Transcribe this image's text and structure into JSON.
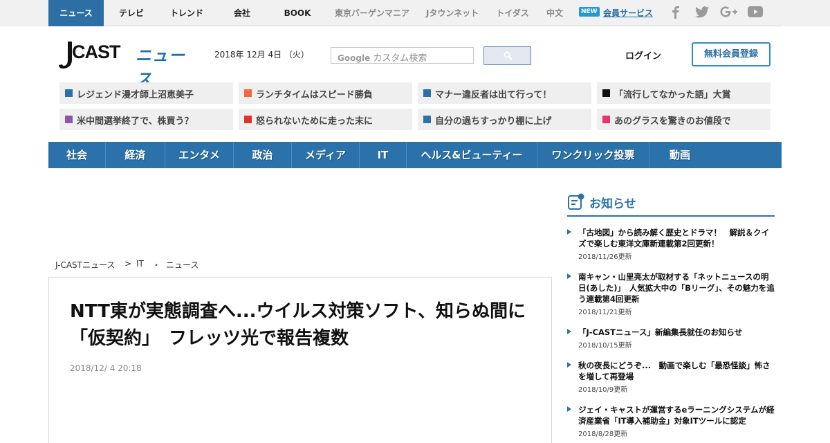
{
  "topnav": {
    "items": [
      {
        "label": "ニュース",
        "active": true
      },
      {
        "label": "テレビ"
      },
      {
        "label": "トレンド"
      },
      {
        "label": "会社"
      },
      {
        "label": "BOOK"
      },
      {
        "label": "東京バーゲンマニア"
      },
      {
        "label": "Jタウンネット"
      },
      {
        "label": "トイダス"
      },
      {
        "label": "中文"
      }
    ],
    "new_badge": "NEW",
    "member_link": "会員サービス",
    "social_icons": [
      "facebook-icon",
      "twitter-icon",
      "google-plus-icon",
      "youtube-icon"
    ]
  },
  "header": {
    "logo_text": "CAST",
    "logo_news": "ニュース",
    "date": "2018年 12月 4日 （火）",
    "search_placeholder": "カスタム検索",
    "search_brand": "Google",
    "login": "ログイン",
    "register": "無料会員登録"
  },
  "topics": [
    {
      "label": "レジェンド漫才師上沼恵美子",
      "color": "#2a72a9"
    },
    {
      "label": "ランチタイムはスピード勝負",
      "color": "#f26a3c"
    },
    {
      "label": "マナー違反者は出て行って！",
      "color": "#2a72a9"
    },
    {
      "label": "「流行してなかった語」大賞",
      "color": "#111111"
    },
    {
      "label": "米中間選挙終了で、株買う？",
      "color": "#8e56a8"
    },
    {
      "label": "怒られないために走った末に",
      "color": "#e0342a"
    },
    {
      "label": "自分の過ちすっかり棚に上げ",
      "color": "#2a72a9"
    },
    {
      "label": "あのグラスを驚きのお値段で",
      "color": "#e8336b"
    }
  ],
  "categories": [
    "社会",
    "経済",
    "エンタメ",
    "政治",
    "メディア",
    "IT",
    "ヘルス&ビューティー",
    "ワンクリック投票",
    "動画"
  ],
  "breadcrumb": {
    "home": "J-CASTニュース",
    "sep1": ">",
    "section": "IT",
    "sep2": "・",
    "sub": "ニュース"
  },
  "article": {
    "title": "NTT東が実態調査へ...ウイルス対策ソフト、知らぬ間に「仮契約」　フレッツ光で報告複数",
    "date": "2018/12/ 4 20:18"
  },
  "sidebar": {
    "title": "お知らせ",
    "items": [
      {
        "text": "「古地図」から読み解く歴史とドラマ！　解説＆クイズで楽しむ東洋文庫新連載第2回更新！",
        "date": "2018/11/26更新"
      },
      {
        "text": "南キャン・山里亮太が取材する「ネットニュースの明日(あした)」　人気拡大中の「Bリーグ」、その魅力を追う連載第4回更新",
        "date": "2018/11/21更新"
      },
      {
        "text": "「J-CASTニュース」新編集長就任のお知らせ",
        "date": "2018/10/15更新"
      },
      {
        "text": "秋の夜長にどうぞ...　動画で楽しむ「最恐怪談」怖さを増して再登場",
        "date": "2018/10/9更新"
      },
      {
        "text": "ジェイ・キャストが運営するeラーニングシステムが経済産業省「IT導入補助金」対象ITツールに認定",
        "date": "2018/8/28更新"
      }
    ]
  }
}
